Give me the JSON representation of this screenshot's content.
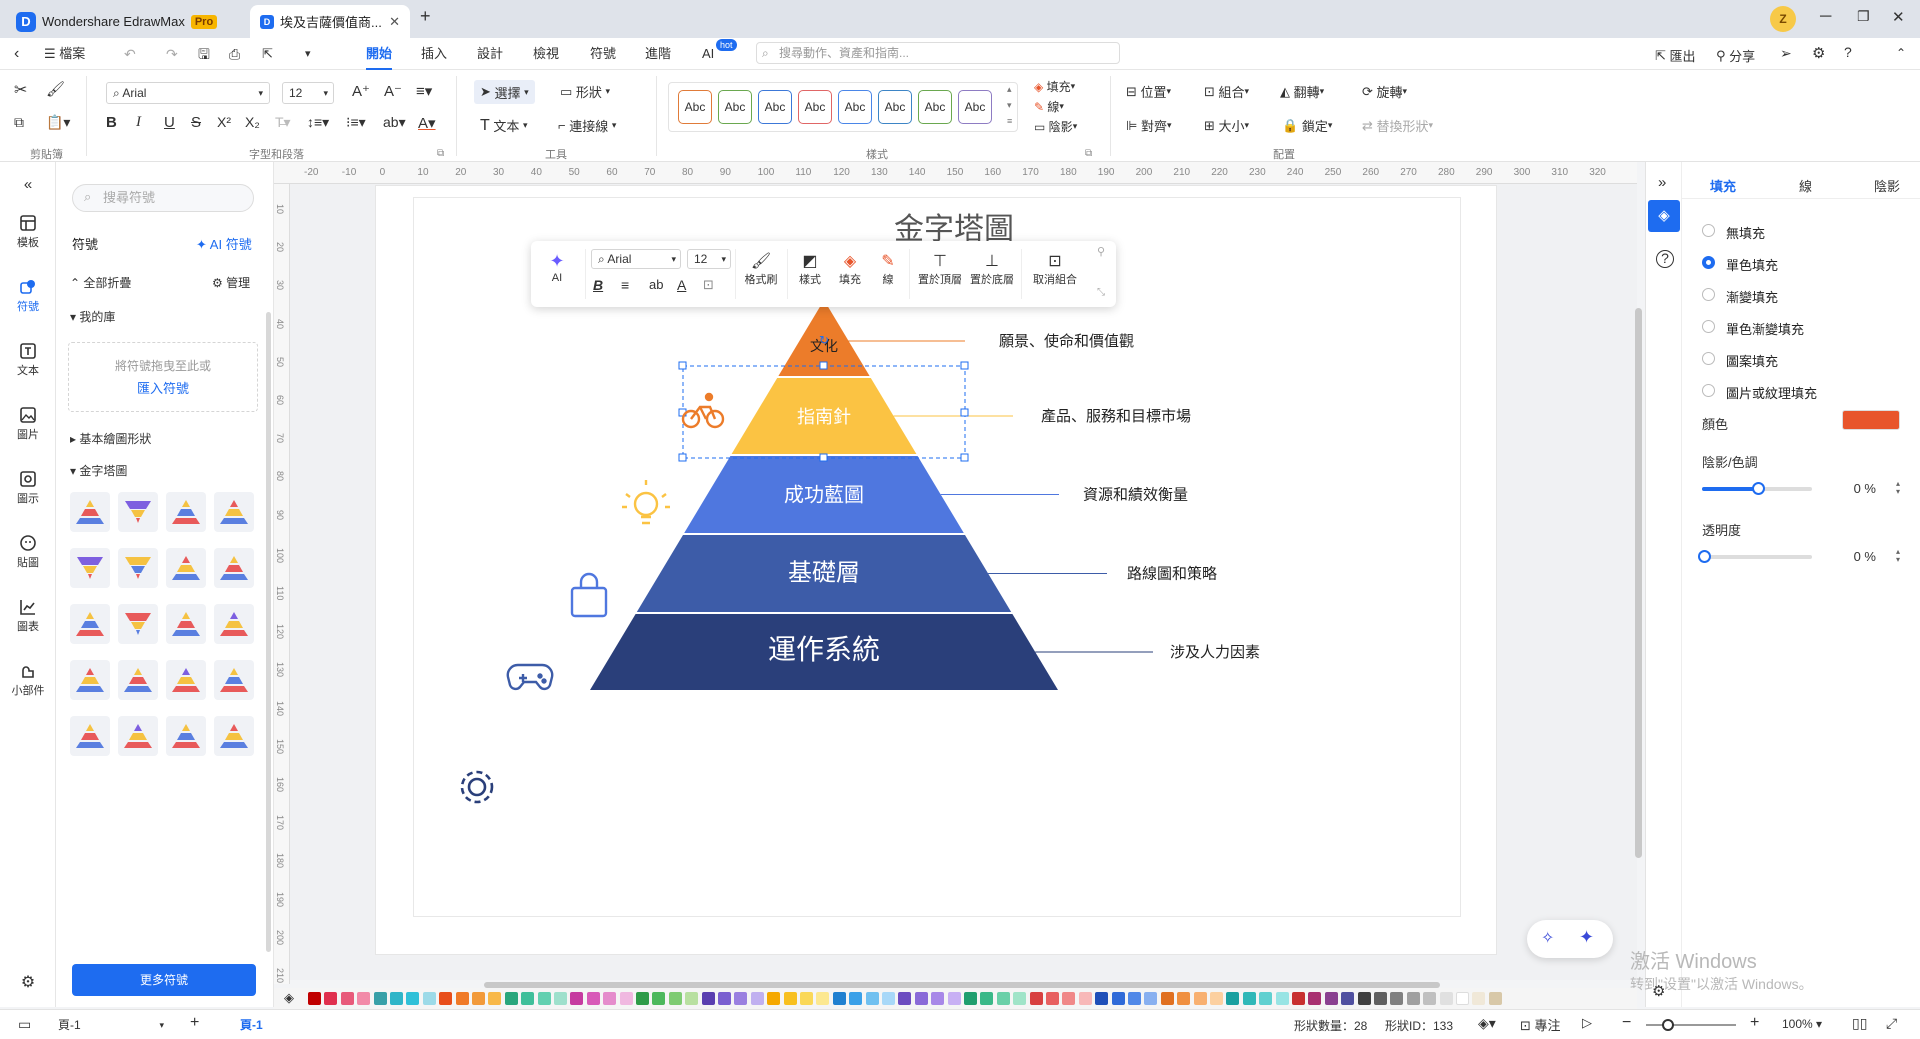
{
  "window": {
    "app_tab": "Wondershare EdrawMax",
    "pro_badge": "Pro",
    "doc_tab": "埃及吉薩價值商..."
  },
  "menubar": {
    "file_label": "檔案",
    "tabs": [
      "開始",
      "插入",
      "設計",
      "檢視",
      "符號",
      "進階",
      "AI"
    ],
    "ai_badge": "hot",
    "search_placeholder": "搜尋動作、資產和指南...",
    "export_label": "匯出",
    "share_label": "分享"
  },
  "ribbon": {
    "font_name": "Arial",
    "font_size": "12",
    "select_label": "選擇",
    "shape_label": "形狀",
    "text_label": "文本",
    "connector_label": "連接線",
    "style_sample": "Abc",
    "fill_label": "填充",
    "line_label": "線",
    "shadow_label": "陰影",
    "position_label": "位置",
    "group_label": "組合",
    "flip_label": "翻轉",
    "rotate_label": "旋轉",
    "align_label": "對齊",
    "size_label": "大小",
    "lock_label": "鎖定",
    "replace_label": "替換形狀",
    "groups": {
      "clipboard": "剪貼簿",
      "font": "字型和段落",
      "tools": "工具",
      "styles": "樣式",
      "arrange": "配置"
    },
    "style_colors": [
      "#e07b39",
      "#6aa84f",
      "#3c78d8",
      "#e06666",
      "#4a86e8",
      "#3d85c6",
      "#6aa84f",
      "#8e7cc3"
    ]
  },
  "leftrail": {
    "items": [
      "模板",
      "符號",
      "文本",
      "圖片",
      "圖示",
      "貼圖",
      "圖表",
      "小部件"
    ]
  },
  "sympanel": {
    "search_placeholder": "搜尋符號",
    "title": "符號",
    "ai_symbol": "AI 符號",
    "collapse_all": "全部折疊",
    "manage": "管理",
    "my_library": "我的庫",
    "drop_hint": "將符號拖曳至此或",
    "import_link": "匯入符號",
    "basic_shapes": "基本繪圖形狀",
    "pyramid_section": "金字塔圖",
    "more_button": "更多符號"
  },
  "ruler": {
    "ticks": [
      "-20",
      "-10",
      "0",
      "10",
      "20",
      "30",
      "40",
      "50",
      "60",
      "70",
      "80",
      "90",
      "100",
      "110",
      "120",
      "130",
      "140",
      "150",
      "160",
      "170",
      "180",
      "190",
      "200",
      "210",
      "220",
      "230",
      "240",
      "250",
      "260",
      "270",
      "280",
      "290",
      "300",
      "310",
      "320"
    ],
    "vticks": [
      "10",
      "20",
      "30",
      "40",
      "50",
      "60",
      "70",
      "80",
      "90",
      "100",
      "110",
      "120",
      "130",
      "140",
      "150",
      "160",
      "170",
      "180",
      "190",
      "200",
      "210"
    ]
  },
  "diagram": {
    "title": "金字塔圖",
    "tiers": [
      {
        "name": "文化",
        "label": "願景、使命和價值觀",
        "color": "#ec7c2a"
      },
      {
        "name": "指南針",
        "label": "產品、服務和目標市場",
        "color": "#fbc343"
      },
      {
        "name": "成功藍圖",
        "label": "資源和績效衡量",
        "color": "#4f77df"
      },
      {
        "name": "基礎層",
        "label": "路線圖和策略",
        "color": "#3d5ca8"
      },
      {
        "name": "運作系統",
        "label": "涉及人力因素",
        "color": "#2a3f7a"
      }
    ]
  },
  "floattb": {
    "ai": "AI",
    "font": "Arial",
    "size": "12",
    "format_painter": "格式刷",
    "style": "樣式",
    "fill": "填充",
    "line": "線",
    "bring_top": "置於頂層",
    "send_bottom": "置於底層",
    "ungroup": "取消組合"
  },
  "rightpanel": {
    "tabs": [
      "填充",
      "線",
      "陰影"
    ],
    "options": [
      "無填充",
      "單色填充",
      "漸變填充",
      "單色漸變填充",
      "圖案填充",
      "圖片或紋理填充"
    ],
    "selected_option": 1,
    "color_label": "顏色",
    "fill_color": "#e8552b",
    "shade_label": "陰影/色調",
    "shade_value": "0 %",
    "transparency_label": "透明度",
    "transparency_value": "0 %"
  },
  "status": {
    "page_select": "頁-1",
    "page_tab": "頁-1",
    "shape_count": "形狀數量：28",
    "shape_id": "形狀ID：133",
    "focus": "專注",
    "zoom": "100%"
  },
  "watermark": {
    "line1": "激活 Windows",
    "line2": "转到\"设置\"以激活 Windows。"
  },
  "palette": [
    "#c00000",
    "#e0304e",
    "#e85a7a",
    "#f28aa8",
    "#38a0a8",
    "#2fb5c8",
    "#30c0d8",
    "#9cdae8",
    "#e84e1b",
    "#f07a28",
    "#f29a3a",
    "#f8b848",
    "#29a67c",
    "#3fbf9a",
    "#62d0b0",
    "#9ee0cc",
    "#c63ba0",
    "#d85ab8",
    "#e58ccc",
    "#f0b8e0",
    "#2e9b48",
    "#4cb85c",
    "#7ecb72",
    "#b8e0a0",
    "#5a3fb0",
    "#7a5fd0",
    "#9a80e0",
    "#c0b0f0",
    "#f5a800",
    "#f8c020",
    "#fad858",
    "#fce890",
    "#2080d0",
    "#3aa0e8",
    "#70c0f0",
    "#a8d8f8",
    "#6c4cc0",
    "#8a6ad8",
    "#a888e8",
    "#c8b0f4",
    "#1f9e6e",
    "#3ab888",
    "#6ad0a8",
    "#a0e4c8",
    "#d84040",
    "#e86060",
    "#f08888",
    "#f8b8b8",
    "#1f4fb8",
    "#2f6ad8",
    "#5088e8",
    "#88b0f0",
    "#e07020",
    "#f09040",
    "#f8b070",
    "#fcd0a0",
    "#1aa0a0",
    "#30b8b8",
    "#60d0d0",
    "#98e4e4",
    "#c83030",
    "#a83070",
    "#8a4090",
    "#5050a0",
    "#404040",
    "#606060",
    "#808080",
    "#a0a0a0",
    "#c0c0c0",
    "#e0e0e0",
    "#ffffff",
    "#f0e8d8",
    "#d8c8a8"
  ]
}
